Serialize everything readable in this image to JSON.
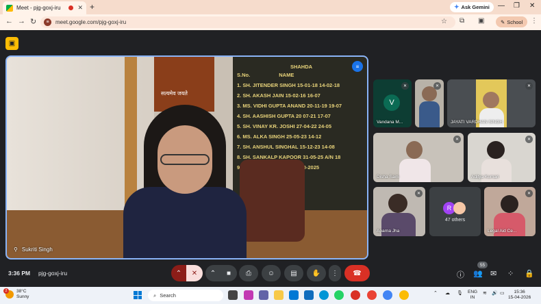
{
  "browser": {
    "tab_title": "Meet - pjg-goxj-iru",
    "new_tab": "+",
    "ask_gemini": "Ask Gemini",
    "url": "meet.google.com/pjg-goxj-iru",
    "profile": "School"
  },
  "meet": {
    "main_speaker": "Sukriti Singh",
    "emblem_text": "सत्यमेव जयते",
    "board": {
      "header_top": "SHAHDA",
      "header_sno": "S.No.",
      "header_name": "NAME",
      "rows": [
        "1.  SH. JITENDER SINGH     15-01-18   14-02-18",
        "2.  SH. AKASH JAIN         15-02-16   16-07",
        "3.  MS. VIDHI GUPTA ANAND  20-11-19   19-07",
        "4.  SH. AASHISH GUPTA      20 07-21   17-07",
        "5.  SH. VINAY KR. JOSHI    27-04-22   24-05",
        "6.  MS. ALKA SINGH         25-05-23   14-12",
        "7.  SH. ANSHUL SINGHAL     15-12-23   14-08",
        "8.  SH. SANKALP KAPOOR     31-05-25 A/N 18",
        "9.  MS. SUKRITI SINGH      18-10-2025"
      ]
    },
    "participants": [
      {
        "name": "Vandana M...",
        "initial": "V"
      },
      {
        "name": ""
      },
      {
        "name": "JAYATI VARDHAN SINGH"
      },
      {
        "name": "Disha Saini"
      },
      {
        "name": "Aditya Kumari"
      },
      {
        "name": "Aparna Jha"
      },
      {
        "name": "Legal Aid Ce..."
      }
    ],
    "others": {
      "count_label": "47 others",
      "initial": "R"
    },
    "bottom": {
      "time": "3:36 PM",
      "code": "pjg-goxj-iru",
      "people_count": "55"
    }
  },
  "taskbar": {
    "temp": "38°C",
    "weather": "Sunny",
    "weather_badge": "2",
    "search_placeholder": "Search",
    "lang1": "ENG",
    "lang2": "IN",
    "time": "15:36",
    "date": "15-04-2026"
  }
}
